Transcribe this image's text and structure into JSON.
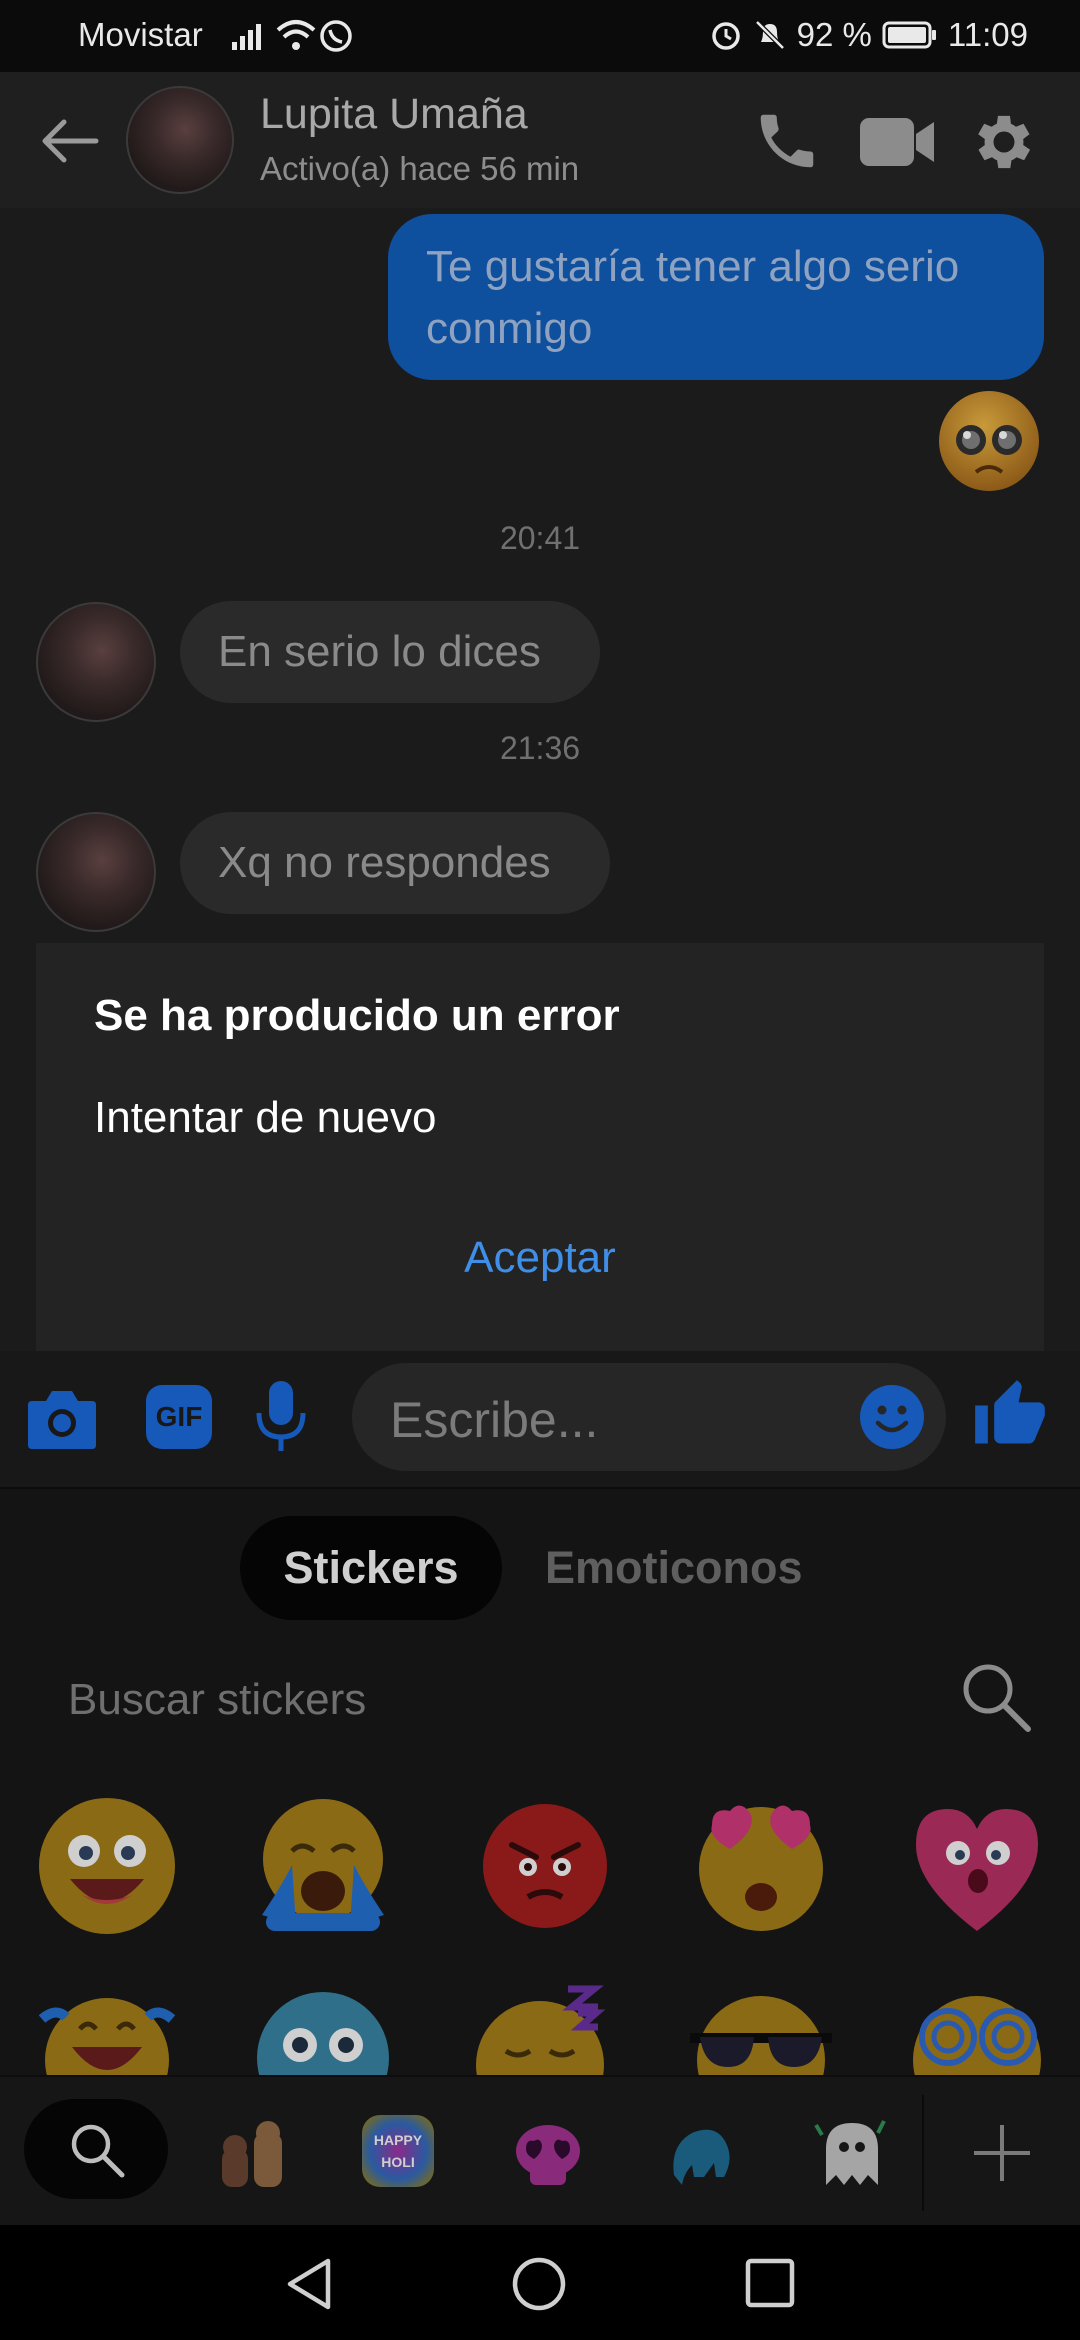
{
  "status_bar": {
    "carrier": "Movistar",
    "battery": "92 %",
    "time": "11:09"
  },
  "header": {
    "contact_name": "Lupita Umaña",
    "contact_status": "Activo(a) hace 56 min",
    "icons": [
      "back-arrow-icon",
      "phone-icon",
      "video-icon",
      "gear-icon"
    ]
  },
  "chat": {
    "messages": [
      {
        "direction": "out",
        "text": "Te gustaría tener algo serio conmigo"
      },
      {
        "direction": "out",
        "type": "emoji",
        "emoji": "pleading-face"
      },
      {
        "type": "timestamp",
        "text": "20:41"
      },
      {
        "direction": "in",
        "text": "En serio lo dices"
      },
      {
        "type": "timestamp",
        "text": "21:36"
      },
      {
        "direction": "in",
        "text": "Xq no respondes"
      }
    ]
  },
  "dialog": {
    "title": "Se ha producido un error",
    "message": "Intentar de nuevo",
    "ok_label": "Aceptar"
  },
  "composer": {
    "placeholder": "Escribe...",
    "icons": [
      "camera-icon",
      "gif-icon",
      "microphone-icon",
      "smiley-icon",
      "like-thumb-icon"
    ],
    "gif_label": "GIF"
  },
  "sticker_panel": {
    "tabs": [
      "Stickers",
      "Emoticonos"
    ],
    "active_tab": "Stickers",
    "search_placeholder": "Buscar stickers",
    "stickers_row1": [
      "grinning-face",
      "crying-face",
      "angry-face",
      "heart-eyes-face",
      "heart-face"
    ],
    "stickers_row2": [
      "laughing-tears-face",
      "scared-face",
      "sleepy-face",
      "sunglasses-face",
      "dizzy-face"
    ],
    "tray_items": [
      "search-icon",
      "bears-pack-icon",
      "happy-holi-pack-icon",
      "skull-pack-icon",
      "elephant-pack-icon",
      "ghost-pack-icon",
      "add-icon"
    ],
    "holi_text": "HAPPY HOLI"
  },
  "colors": {
    "accent_blue": "#3f8ee8",
    "outgoing_bubble": "#0e4f9e"
  }
}
